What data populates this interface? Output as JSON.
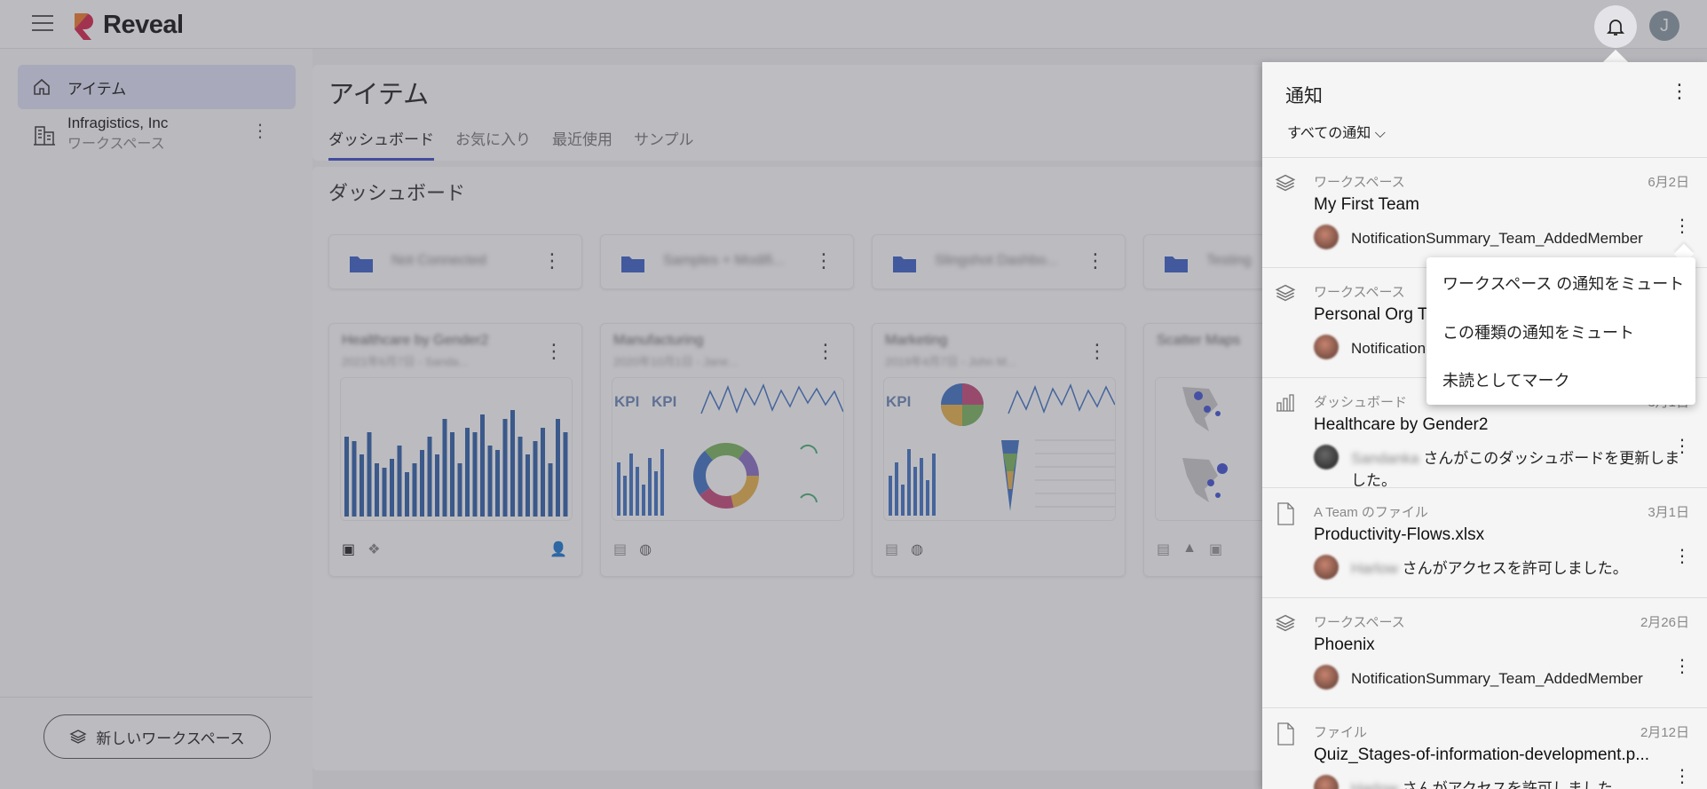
{
  "app": {
    "name": "Reveal",
    "user_initial": "J"
  },
  "sidebar": {
    "items": [
      {
        "label": "アイテム"
      },
      {
        "label": "Infragistics, Inc",
        "sublabel": "ワークスペース"
      }
    ],
    "new_workspace": "新しいワークスペース"
  },
  "main": {
    "title": "アイテム",
    "tabs": [
      {
        "label": "ダッシュボード"
      },
      {
        "label": "お気に入り"
      },
      {
        "label": "最近使用"
      },
      {
        "label": "サンプル"
      }
    ],
    "section_title": "ダッシュボード",
    "folders": [
      {
        "name": "Not Connected"
      },
      {
        "name": "Samples + Modifi..."
      },
      {
        "name": "Slingshot Dashbo..."
      },
      {
        "name": "Testing"
      }
    ],
    "cards": [
      {
        "title": "Healthcare by Gender2",
        "sub": "2021年6月7日 - Sanda..."
      },
      {
        "title": "Manufacturing",
        "sub": "2020年10月1日 - Jane..."
      },
      {
        "title": "Marketing",
        "sub": "2019年4月7日 - John M..."
      },
      {
        "title": "Scatter Maps",
        "sub": ""
      }
    ]
  },
  "notifications": {
    "title": "通知",
    "filter": "すべての通知",
    "items": [
      {
        "category": "ワークスペース",
        "date": "6月2日",
        "name": "My First Team",
        "message": "NotificationSummary_Team_AddedMember",
        "user": ""
      },
      {
        "category": "ワークスペース",
        "date": "",
        "name": "Personal Org T",
        "message": "Notification",
        "user": ""
      },
      {
        "category": "ダッシュボード",
        "date": "3月1日",
        "name": "Healthcare by Gender2",
        "message": "さんがこのダッシュボードを更新しました。",
        "user": "Sandanka"
      },
      {
        "category": "A Team のファイル",
        "date": "3月1日",
        "name": "Productivity-Flows.xlsx",
        "message": "さんがアクセスを許可しました。",
        "user": "Harlow"
      },
      {
        "category": "ワークスペース",
        "date": "2月26日",
        "name": "Phoenix",
        "message": "NotificationSummary_Team_AddedMember",
        "user": ""
      },
      {
        "category": "ファイル",
        "date": "2月12日",
        "name": "Quiz_Stages-of-information-development.p...",
        "message": "さんがアクセスを許可しました。",
        "user": "Harlow"
      }
    ]
  },
  "context_menu": {
    "items": [
      {
        "label": "ワークスペース の通知をミュート"
      },
      {
        "label": "この種類の通知をミュート"
      },
      {
        "label": "未読としてマーク"
      }
    ]
  },
  "colors": {
    "accent": "#3b4bc8",
    "folder": "#3b5fc8",
    "bar": "#2f5fa8"
  }
}
